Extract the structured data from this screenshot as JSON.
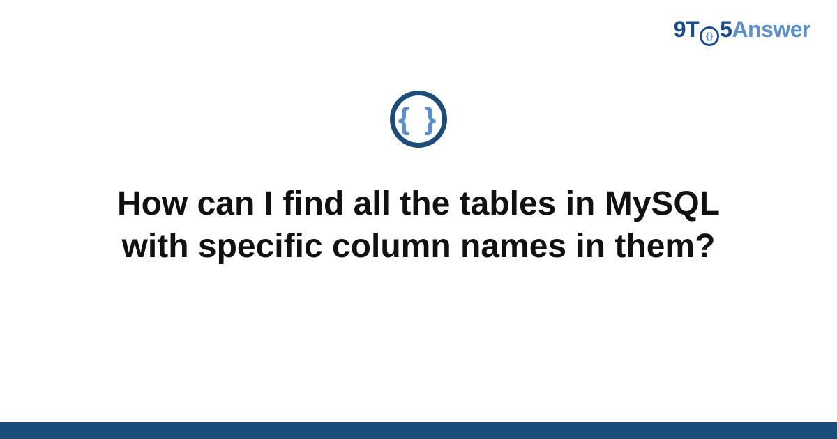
{
  "logo": {
    "part1": "9T",
    "part_o_inner": "{}",
    "part2": "5",
    "part3": "Answer"
  },
  "icon": {
    "name": "braces-icon",
    "glyph": "{ }"
  },
  "title": "How can I find all the tables in MySQL with specific column names in them?",
  "colors": {
    "brand_dark": "#1a4d7a",
    "brand_light": "#5a8fc7"
  }
}
